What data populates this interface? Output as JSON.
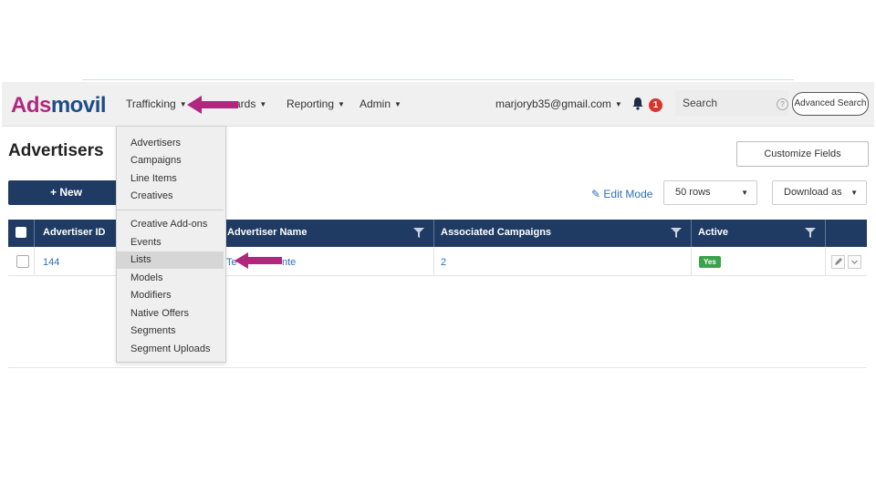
{
  "brand": {
    "logo_part1": "Ads",
    "logo_part2": "movil"
  },
  "nav": {
    "trafficking": "Trafficking",
    "dashboards_partial": "ards",
    "reporting": "Reporting",
    "admin": "Admin",
    "user_email": "marjoryb35@gmail.com",
    "notification_count": "1",
    "search_placeholder": "Search",
    "advanced_search": "Advanced Search"
  },
  "trafficking_menu": {
    "group1": [
      "Advertisers",
      "Campaigns",
      "Line Items",
      "Creatives"
    ],
    "group2": [
      "Creative Add-ons",
      "Events",
      "Lists",
      "Models",
      "Modifiers",
      "Native Offers",
      "Segments",
      "Segment Uploads"
    ],
    "highlighted": "Lists"
  },
  "page": {
    "title": "Advertisers",
    "customize_fields": "Customize Fields",
    "new_button": "+ New",
    "edit_mode": "Edit Mode",
    "rows_select": "50 rows",
    "download_as": "Download as"
  },
  "table": {
    "columns": [
      "Advertiser ID",
      "Advertiser Name",
      "Associated Campaigns",
      "Active"
    ],
    "rows": [
      {
        "advertiser_id": "144",
        "advertiser_name_partial_left": "Te",
        "advertiser_name_partial_right": "nte",
        "associated_campaigns": "2",
        "active": "Yes"
      }
    ]
  },
  "colors": {
    "brand_pink": "#b0287e",
    "brand_navy": "#1f4c86",
    "header_navy": "#1f3b63",
    "link_blue": "#2c6fb3",
    "annotation_arrow": "#b0287e",
    "active_green": "#3ba34b",
    "badge_red": "#d9342b"
  }
}
